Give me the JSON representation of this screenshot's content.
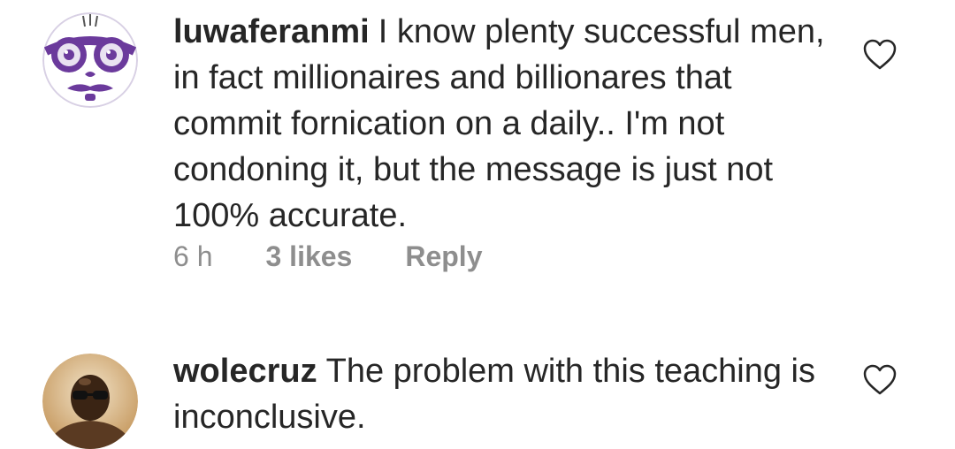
{
  "comments": [
    {
      "username": "luwaferanmi",
      "text": "I know plenty successful men, in fact millionaires and billionares that commit fornication on a daily.. I'm not condoning it, but the message is just not 100% accurate.",
      "time": "6 h",
      "likes": "3 likes",
      "reply_label": "Reply",
      "avatar_icon": "cartoon-face-avatar",
      "like_icon": "heart-outline-icon"
    },
    {
      "username": "wolecruz",
      "text": "The problem with this teaching is inconclusive.",
      "avatar_icon": "user-photo-avatar",
      "like_icon": "heart-outline-icon"
    }
  ],
  "colors": {
    "text": "#262626",
    "meta": "#8e8e8e",
    "avatar_purple": "#6b3a9c"
  }
}
